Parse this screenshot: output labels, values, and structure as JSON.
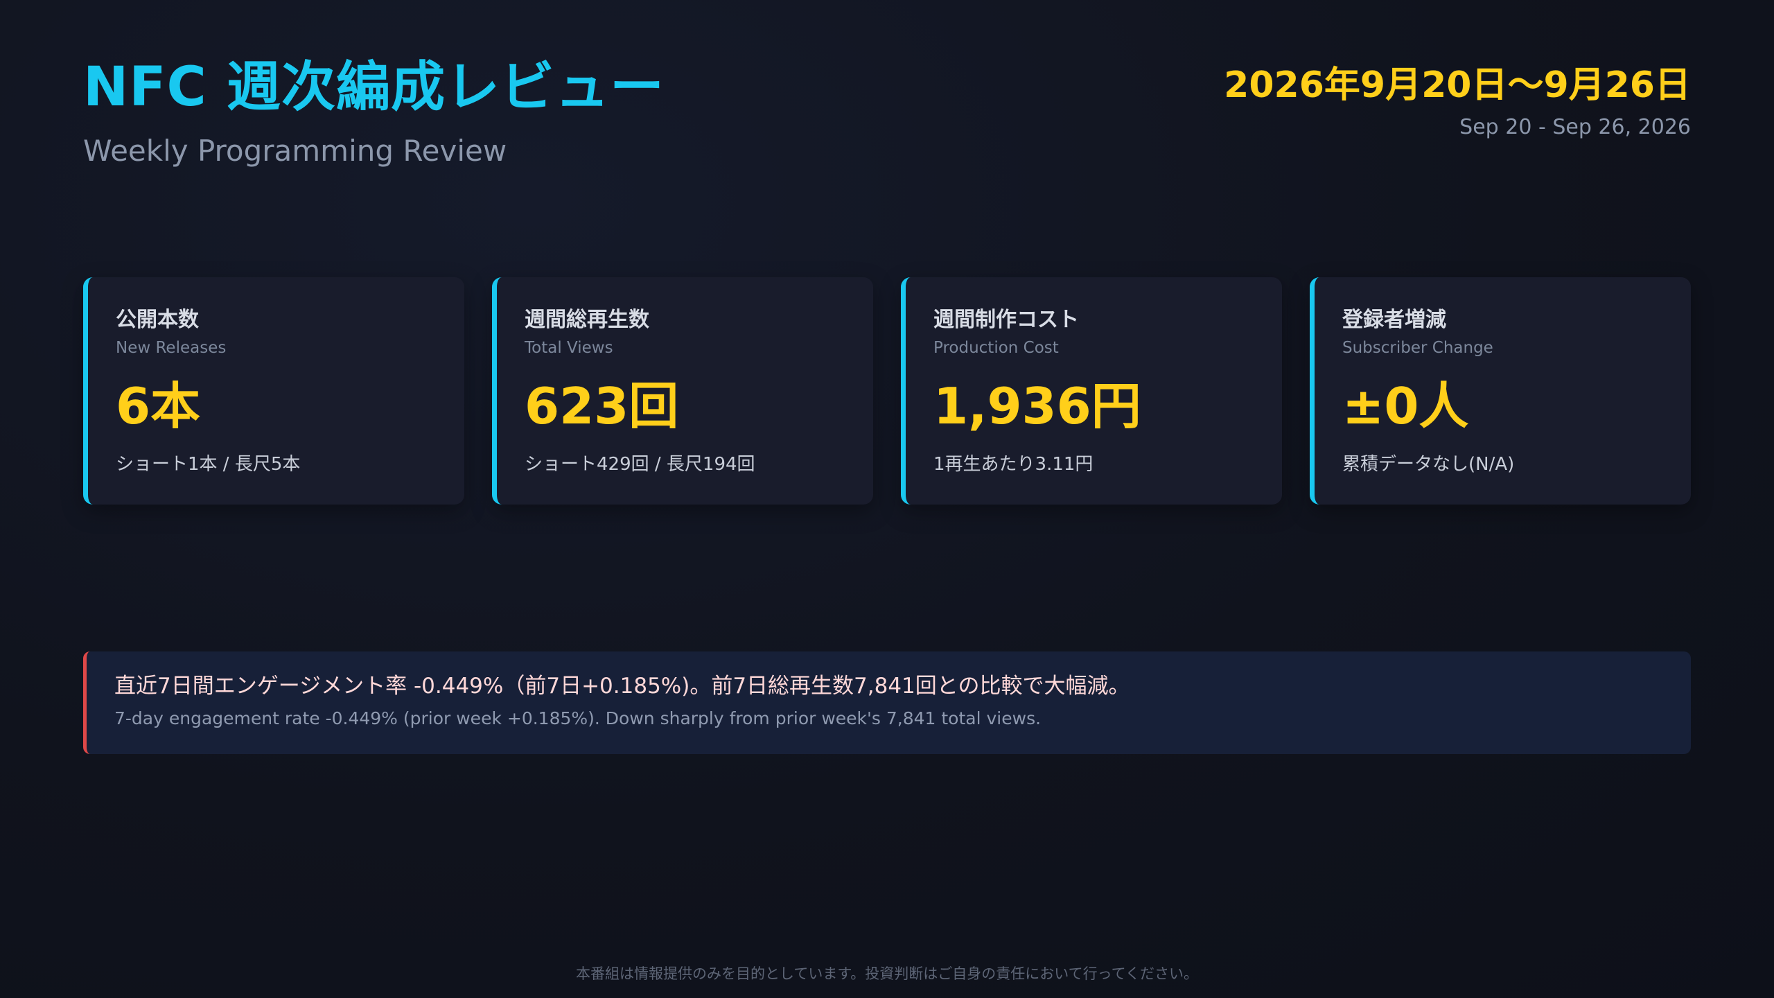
{
  "header": {
    "title": "NFC 週次編成レビュー",
    "subtitle": "Weekly Programming Review",
    "date_jp": "2026年9月20日〜9月26日",
    "date_en": "Sep 20 - Sep 26, 2026"
  },
  "cards": [
    {
      "label_jp": "公開本数",
      "label_en": "New Releases",
      "value": "6本",
      "detail": "ショート1本 / 長尺5本"
    },
    {
      "label_jp": "週間総再生数",
      "label_en": "Total Views",
      "value": "623回",
      "detail": "ショート429回 / 長尺194回"
    },
    {
      "label_jp": "週間制作コスト",
      "label_en": "Production Cost",
      "value": "1,936円",
      "detail": "1再生あたり3.11円"
    },
    {
      "label_jp": "登録者増減",
      "label_en": "Subscriber Change",
      "value": "±0人",
      "detail": "累積データなし(N/A)"
    }
  ],
  "alert": {
    "text_jp": "直近7日間エンゲージメント率 -0.449%（前7日+0.185%)。前7日総再生数7,841回との比較で大幅減。",
    "text_en": "7-day engagement rate -0.449% (prior week +0.185%). Down sharply from prior week's 7,841 total views."
  },
  "footer": {
    "disclaimer": "本番組は情報提供のみを目的としています。投資判断はご自身の責任において行ってください。"
  },
  "colors": {
    "accent_cyan": "#19c8f0",
    "accent_yellow": "#ffcf1a",
    "alert_red": "#e04848",
    "background": "#10131d"
  }
}
